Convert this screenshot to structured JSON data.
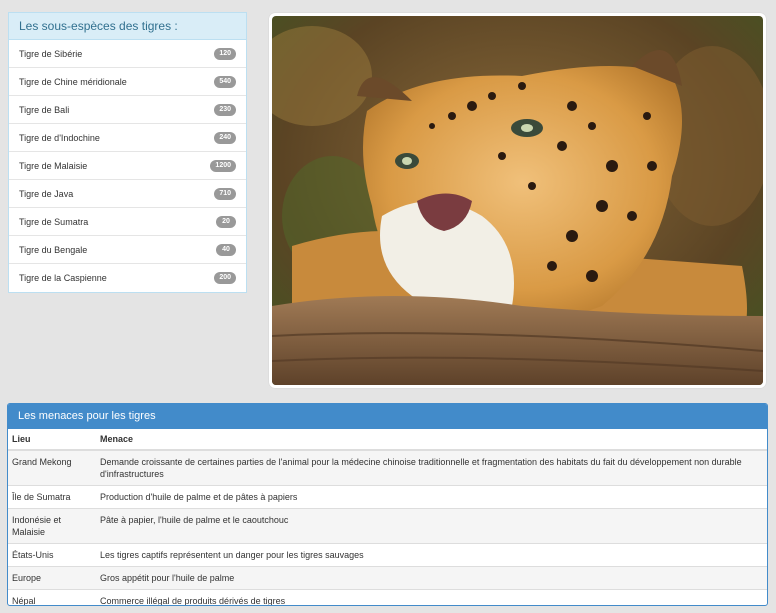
{
  "subspecies": {
    "title": "Les sous-espèces des tigres :",
    "items": [
      {
        "label": "Tigre de Sibérie",
        "count": "120"
      },
      {
        "label": "Tigre de Chine méridionale",
        "count": "540"
      },
      {
        "label": "Tigre de Bali",
        "count": "230"
      },
      {
        "label": "Tigre de d'Indochine",
        "count": "240"
      },
      {
        "label": "Tigre de Malaisie",
        "count": "1200"
      },
      {
        "label": "Tigre de Java",
        "count": "710"
      },
      {
        "label": "Tigre de Sumatra",
        "count": "20"
      },
      {
        "label": "Tigre du Bengale",
        "count": "40"
      },
      {
        "label": "Tigre de la Caspienne",
        "count": "200"
      }
    ]
  },
  "photo": {
    "subject": "jaguar-photo"
  },
  "threats": {
    "title": "Les menaces pour les tigres",
    "columns": [
      "Lieu",
      "Menace"
    ],
    "rows": [
      {
        "place": "Grand Mekong",
        "threat": "Demande croissante de certaines parties de l'animal pour la médecine chinoise traditionnelle et fragmentation des habitats du fait du développement non durable d'infrastructures"
      },
      {
        "place": "Île de Sumatra",
        "threat": "Production d'huile de palme et de pâtes à papiers"
      },
      {
        "place": "Indonésie et Malaisie",
        "threat": "Pâte à papier, l'huile de palme et le caoutchouc"
      },
      {
        "place": "États-Unis",
        "threat": "Les tigres captifs représentent un danger pour les tigres sauvages"
      },
      {
        "place": "Europe",
        "threat": "Gros appétit pour l'huile de palme"
      },
      {
        "place": "Népal",
        "threat": "Commerce illégal de produits dérivés de tigres"
      }
    ]
  }
}
